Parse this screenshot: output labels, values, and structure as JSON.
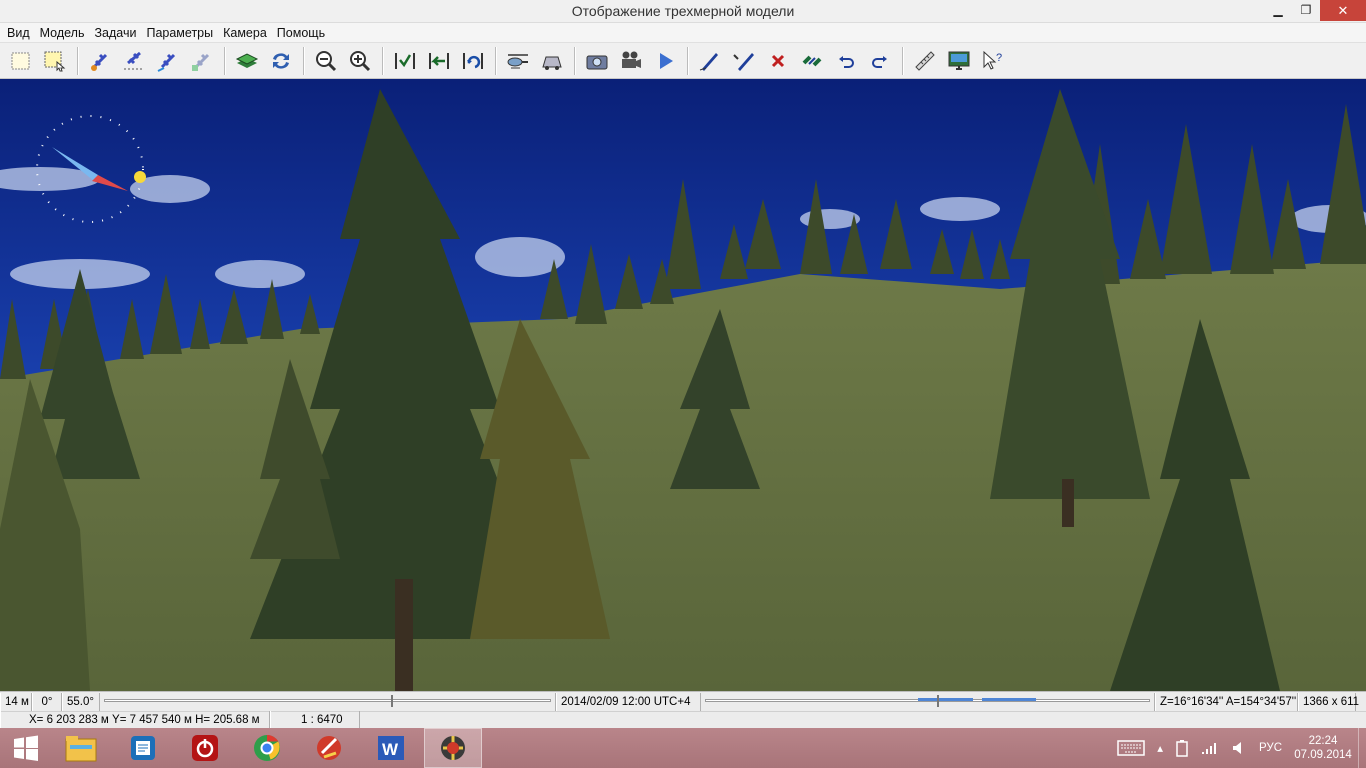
{
  "window": {
    "title": "Отображение трехмерной модели"
  },
  "menu": [
    "Вид",
    "Модель",
    "Задачи",
    "Параметры",
    "Камера",
    "Помощь"
  ],
  "toolbar_icons": [
    "select-area-icon",
    "select-object-icon",
    "plane-settings-icon",
    "plane-path-icon",
    "plane-fly-icon",
    "plane-disabled-icon",
    "layers-icon",
    "refresh-icon",
    "zoom-out-icon",
    "zoom-in-icon",
    "check-view-icon",
    "back-view-icon",
    "rotate-view-icon",
    "helicopter-icon",
    "vehicle-icon",
    "camera-icon",
    "video-camera-icon",
    "play-icon",
    "draw-pen-icon",
    "draw-edit-pen-icon",
    "delete-icon",
    "link-icon",
    "undo-icon",
    "redo-icon",
    "ruler-icon",
    "monitor-icon",
    "help-pointer-icon"
  ],
  "status1": {
    "height": "14 м",
    "heading": "0°",
    "fov": "55.0°",
    "datetime": "2014/02/09  12:00  UTC+4",
    "angles": "Z=16°16'34''  A=154°34'57''",
    "resolution": "1366 x 611",
    "time_slider_value": 0.52,
    "progress_a": [
      0.48,
      0.6
    ],
    "progress_b": [
      0.62,
      0.74
    ]
  },
  "status2": {
    "coords": "X= 6 203 283 м  Y= 7 457 540 м  H= 205.68 м",
    "scale": "1 : 6470"
  },
  "taskbar": {
    "apps": [
      "file-explorer-icon",
      "control-panel-icon",
      "power-icon",
      "chrome-icon",
      "ccleaner-icon",
      "word-icon",
      "map3d-app-icon"
    ],
    "lang": "РУС",
    "time": "22:24",
    "date": "07.09.2014"
  },
  "colors": {
    "sky": "#0d2a86",
    "grass": "#5e6a3c",
    "tree": "#2f3f26",
    "close": "#c7443a",
    "taskbar": "#b07c81"
  }
}
